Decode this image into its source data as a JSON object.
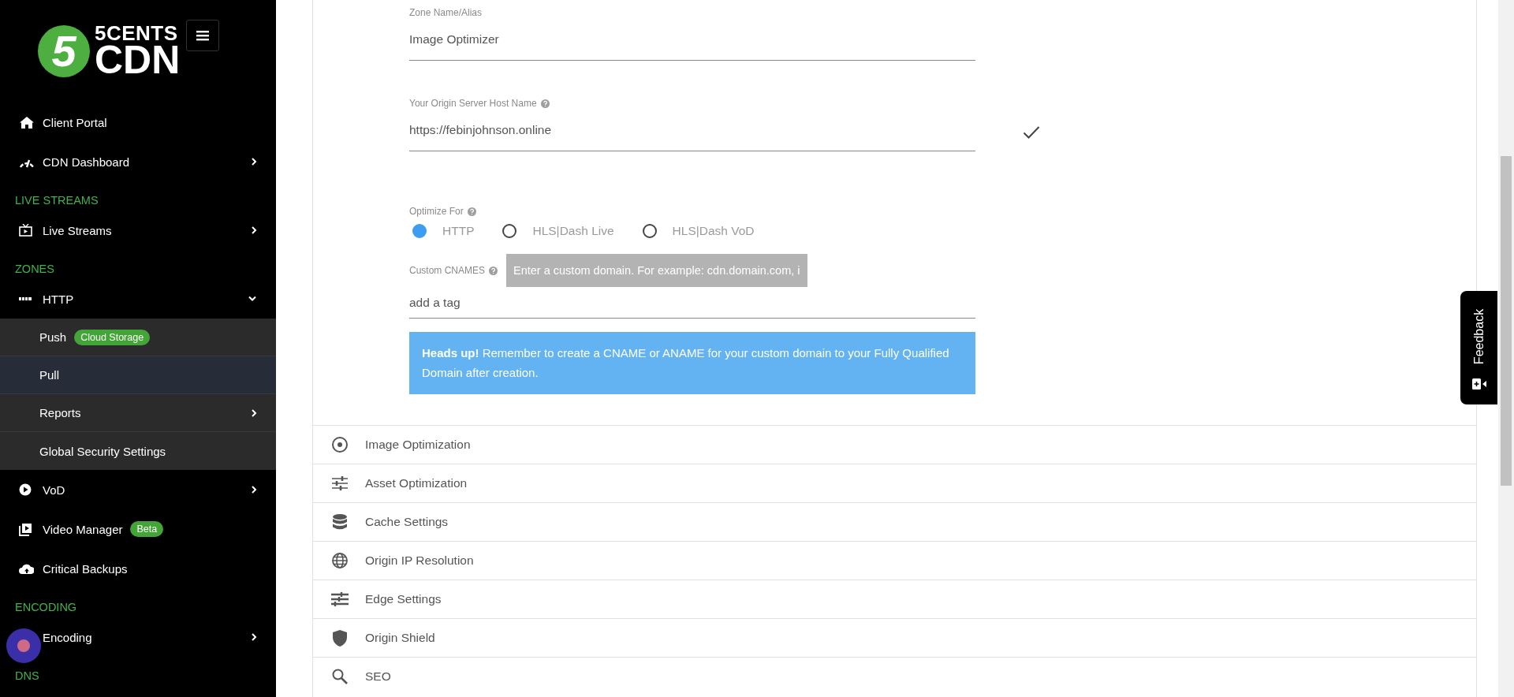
{
  "logo": {
    "badge": "5",
    "line1": "5CENTS",
    "line2": "CDN"
  },
  "sidebar": {
    "items": [
      {
        "kind": "item",
        "label": "Client Portal",
        "selected": false
      },
      {
        "kind": "item",
        "label": "CDN Dashboard",
        "selected": false,
        "expanded": false
      },
      {
        "kind": "section",
        "label": "LIVE STREAMS"
      },
      {
        "kind": "item",
        "label": "Live Streams",
        "selected": false,
        "expanded": false
      },
      {
        "kind": "section",
        "label": "ZONES"
      },
      {
        "kind": "item",
        "label": "HTTP",
        "selected": false,
        "expanded": true,
        "children": [
          {
            "label": "Push",
            "selected": false,
            "badge": "Cloud Storage"
          },
          {
            "label": "Pull",
            "selected": true
          },
          {
            "label": "Reports",
            "selected": false,
            "expanded": false
          },
          {
            "label": "Global Security Settings",
            "selected": false
          }
        ]
      },
      {
        "kind": "item",
        "label": "VoD",
        "selected": false,
        "expanded": false
      },
      {
        "kind": "item",
        "label": "Video Manager",
        "selected": false,
        "badge": "Beta"
      },
      {
        "kind": "item",
        "label": "Critical Backups",
        "selected": false
      },
      {
        "kind": "section",
        "label": "ENCODING"
      },
      {
        "kind": "item",
        "label": "Encoding",
        "selected": false,
        "expanded": false
      },
      {
        "kind": "section",
        "label": "DNS"
      }
    ]
  },
  "form": {
    "fields": [
      {
        "label": "Zone Name/Alias",
        "help": false,
        "value": "Image Optimizer",
        "valid": false
      },
      {
        "label": "Your Origin Server Host Name",
        "help": true,
        "value": "https://febinjohnson.online",
        "valid": true
      }
    ],
    "optimize_for": {
      "label": "Optimize For",
      "help": true,
      "options": [
        {
          "label": "HTTP",
          "selected": true
        },
        {
          "label": "HLS|Dash Live",
          "selected": false
        },
        {
          "label": "HLS|Dash VoD",
          "selected": false
        }
      ]
    },
    "custom_cnames": {
      "label": "Custom CNAMES",
      "help": true,
      "tooltip": "Enter a custom domain. For example: cdn.domain.com, i",
      "placeholder": "add a tag"
    },
    "alert": {
      "text": "**Heads up!** Remember to create a CNAME or ANAME for your custom domain to your Fully Qualified Domain after creation."
    }
  },
  "sections": [
    {
      "label": "Image Optimization"
    },
    {
      "label": "Asset Optimization"
    },
    {
      "label": "Cache Settings"
    },
    {
      "label": "Origin IP Resolution"
    },
    {
      "label": "Edge Settings"
    },
    {
      "label": "Origin Shield"
    },
    {
      "label": "SEO"
    }
  ],
  "feedback_tab": {
    "label": "Feedback"
  }
}
